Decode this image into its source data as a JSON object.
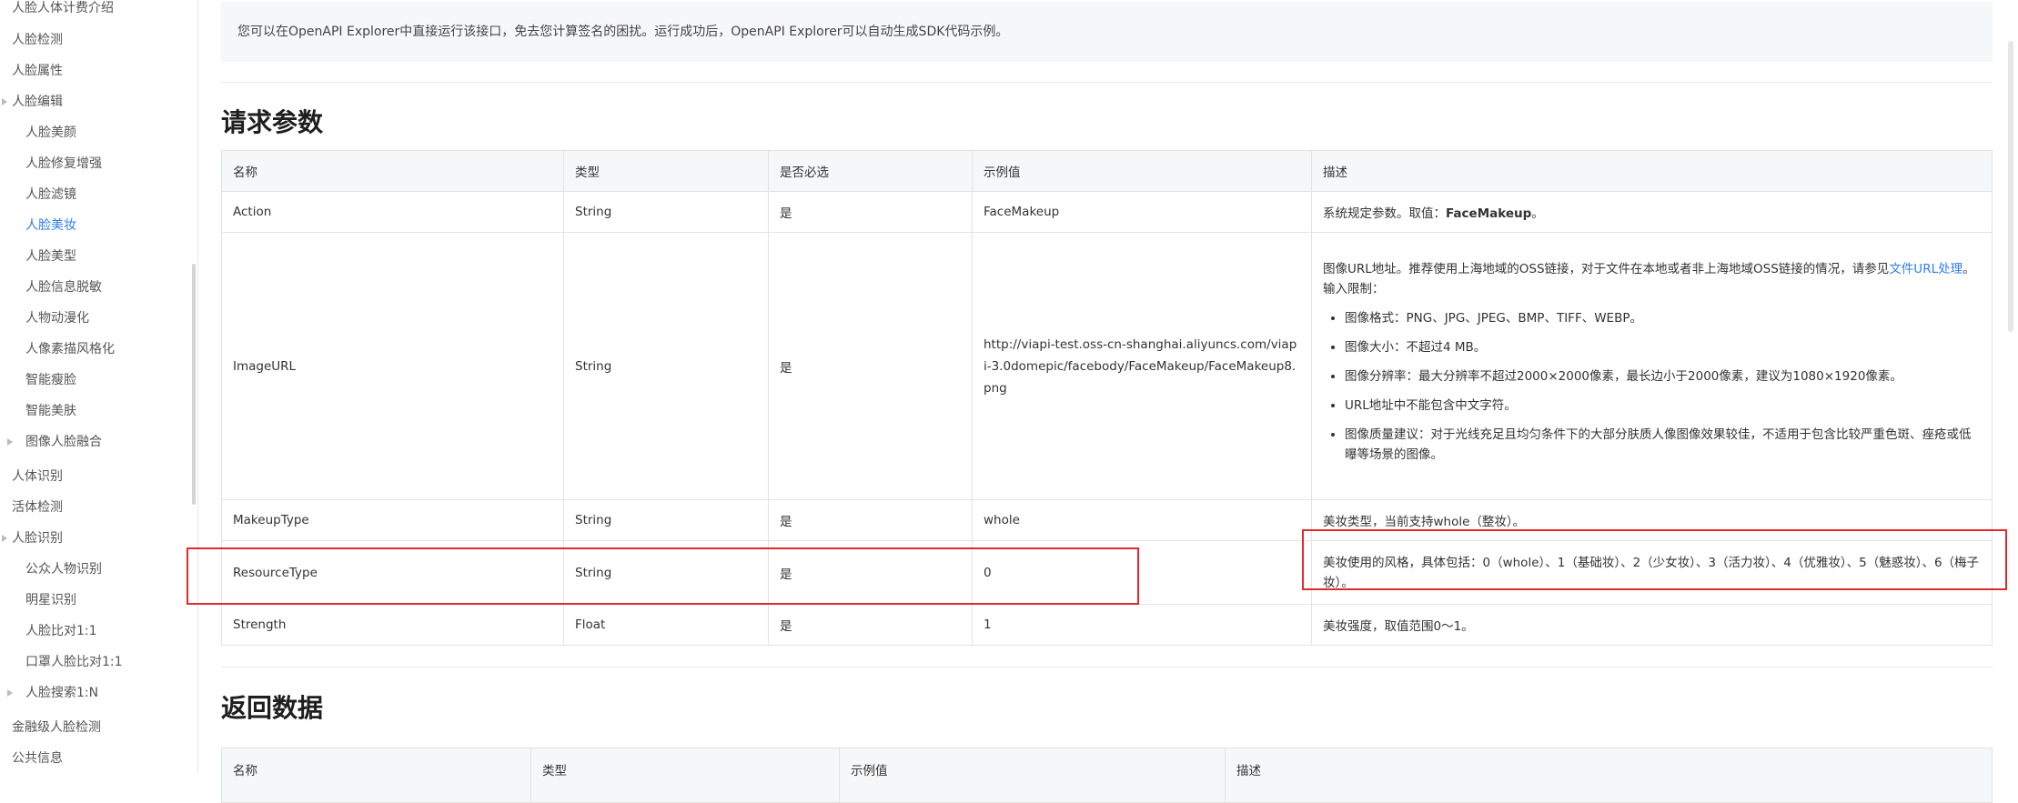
{
  "sidebar": {
    "items": [
      {
        "label": "人脸人体计费介绍",
        "level": 0
      },
      {
        "label": "人脸检测",
        "level": 0
      },
      {
        "label": "人脸属性",
        "level": 0
      },
      {
        "label": "人脸编辑",
        "level": 0,
        "collapsible": true
      },
      {
        "label": "人脸美颜",
        "level": 1
      },
      {
        "label": "人脸修复增强",
        "level": 1
      },
      {
        "label": "人脸滤镜",
        "level": 1
      },
      {
        "label": "人脸美妆",
        "level": 1,
        "active": true
      },
      {
        "label": "人脸美型",
        "level": 1
      },
      {
        "label": "人脸信息脱敏",
        "level": 1
      },
      {
        "label": "人物动漫化",
        "level": 1
      },
      {
        "label": "人像素描风格化",
        "level": 1
      },
      {
        "label": "智能瘦脸",
        "level": 1
      },
      {
        "label": "智能美肤",
        "level": 1
      },
      {
        "label": "图像人脸融合",
        "level": 1,
        "collapsible": true
      },
      {
        "label": "人体识别",
        "level": 0
      },
      {
        "label": "活体检测",
        "level": 0
      },
      {
        "label": "人脸识别",
        "level": 0,
        "collapsible": true
      },
      {
        "label": "公众人物识别",
        "level": 1
      },
      {
        "label": "明星识别",
        "level": 1
      },
      {
        "label": "人脸比对1:1",
        "level": 1
      },
      {
        "label": "口罩人脸比对1:1",
        "level": 1
      },
      {
        "label": "人脸搜索1:N",
        "level": 1,
        "collapsible": true
      },
      {
        "label": "金融级人脸检测",
        "level": 0
      },
      {
        "label": "公共信息",
        "level": 0
      }
    ]
  },
  "notice": "您可以在OpenAPI Explorer中直接运行该接口，免去您计算签名的困扰。运行成功后，OpenAPI Explorer可以自动生成SDK代码示例。",
  "request_section": {
    "title": "请求参数",
    "columns": [
      "名称",
      "类型",
      "是否必选",
      "示例值",
      "描述"
    ],
    "rows": [
      {
        "name": "Action",
        "type": "String",
        "required": "是",
        "example": "FaceMakeup",
        "desc_pre": "系统规定参数。取值：",
        "desc_bold": "FaceMakeup",
        "desc_post": "。"
      },
      {
        "name": "ImageURL",
        "type": "String",
        "required": "是",
        "example": "http://viapi-test.oss-cn-shanghai.aliyuncs.com/viapi-3.0domepic/facebody/FaceMakeup/FaceMakeup8.png",
        "desc_text": "图像URL地址。推荐使用上海地域的OSS链接，对于文件在本地或者非上海地域OSS链接的情况，请参见",
        "desc_link": "文件URL处理",
        "desc_after": "。",
        "desc_limit": "输入限制：",
        "bullets": [
          "图像格式：PNG、JPG、JPEG、BMP、TIFF、WEBP。",
          "图像大小：不超过4 MB。",
          "图像分辨率：最大分辨率不超过2000×2000像素，最长边小于2000像素，建议为1080×1920像素。",
          "URL地址中不能包含中文字符。",
          "图像质量建议：对于光线充足且均匀条件下的大部分肤质人像图像效果较佳，不适用于包含比较严重色斑、痤疮或低曝等场景的图像。"
        ]
      },
      {
        "name": "MakeupType",
        "type": "String",
        "required": "是",
        "example": "whole",
        "desc": "美妆类型，当前支持whole（整妆）。"
      },
      {
        "name": "ResourceType",
        "type": "String",
        "required": "是",
        "example": "0",
        "desc": "美妆使用的风格，具体包括：0（whole）、1（基础妆）、2（少女妆）、3（活力妆）、4（优雅妆）、5（魅惑妆）、6（梅子妆）。"
      },
      {
        "name": "Strength",
        "type": "Float",
        "required": "是",
        "example": "1",
        "desc": "美妆强度，取值范围0～1。"
      }
    ]
  },
  "response_section": {
    "title": "返回数据",
    "columns": [
      "名称",
      "类型",
      "示例值",
      "描述"
    ]
  },
  "colors": {
    "accent": "#2f7ef2",
    "highlight_box": "#e02b2b",
    "header_bg": "#f6f7f8"
  }
}
